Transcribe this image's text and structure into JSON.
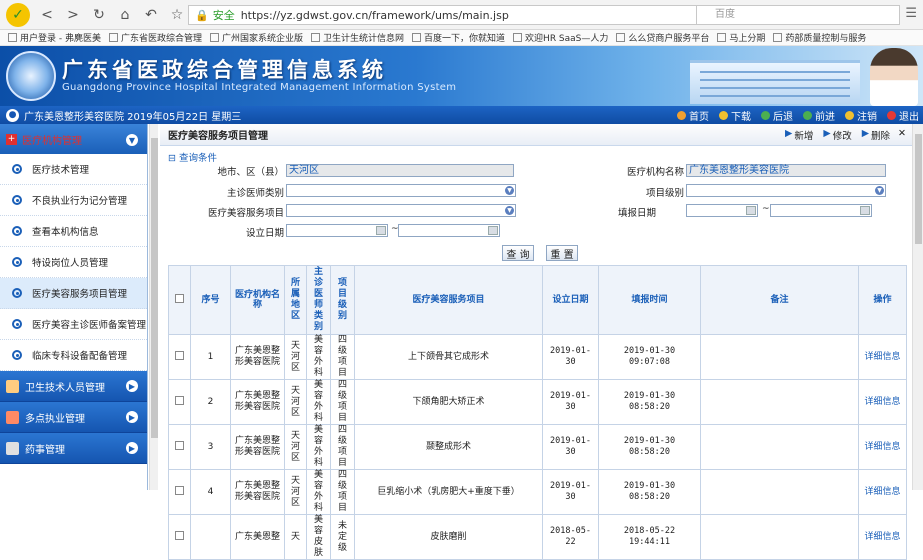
{
  "browser": {
    "secure_label": "安全",
    "url": "https://yz.gdwst.gov.cn/framework/ums/main.jsp",
    "search_placeholder": "百度"
  },
  "bookmarks": [
    "用户登录 - 弗麂医美",
    "广东省医政综合管理",
    "广州国家系统企业版",
    "卫生计生统计信息网",
    "百度一下，你就知道",
    "欢迎HR SaaS—人力",
    "么么贷商户服务平台",
    "马上分期",
    "药部质量控制与服务"
  ],
  "banner": {
    "title": "广东省医政综合管理信息系统",
    "subtitle": "Guangdong Province Hospital Integrated Management Information System"
  },
  "status": {
    "org_date": "广东美恩整形美容医院 2019年05月22日 星期三",
    "actions": [
      "首页",
      "下载",
      "后退",
      "前进",
      "注销",
      "退出"
    ]
  },
  "sidebar": {
    "header": "医疗机构管理",
    "items": [
      "医疗技术管理",
      "不良执业行为记分管理",
      "查看本机构信息",
      "特设岗位人员管理",
      "医疗美容服务项目管理",
      "医疗美容主诊医师备案管理",
      "临床专科设备配备管理"
    ],
    "groups": [
      "卫生技术人员管理",
      "多点执业管理",
      "药事管理"
    ]
  },
  "page": {
    "title": "医疗美容服务项目管理",
    "tools": [
      "新增",
      "修改",
      "删除"
    ],
    "query_label": "查询条件"
  },
  "form": {
    "district_label": "地市、区（县）",
    "district_value": "天河区",
    "org_label": "医疗机构名称",
    "org_value": "广东美恩整形美容医院",
    "doctor_type_label": "主诊医师类别",
    "level_label": "项目级别",
    "service_label": "医疗美容服务项目",
    "report_date_label": "填报日期",
    "set_date_label": "设立日期",
    "search_btn": "查 询",
    "reset_btn": "重 置"
  },
  "table": {
    "headers": [
      "序号",
      "医疗机构名称",
      "所属地区",
      "主诊医师类别",
      "项目级别",
      "医疗美容服务项目",
      "设立日期",
      "填报时间",
      "备注",
      "操作"
    ],
    "rows": [
      {
        "no": "1",
        "org": "广东美恩整形美容医院",
        "area": "天河区",
        "doctor": "美容外科",
        "level": "四级项目",
        "item": "上下颌骨其它成形术",
        "set_date": "2019-01-30",
        "report": "2019-01-30 09:07:08",
        "note": "",
        "op": "详细信息"
      },
      {
        "no": "2",
        "org": "广东美恩整形美容医院",
        "area": "天河区",
        "doctor": "美容外科",
        "level": "四级项目",
        "item": "下颌角肥大矫正术",
        "set_date": "2019-01-30",
        "report": "2019-01-30 08:58:20",
        "note": "",
        "op": "详细信息"
      },
      {
        "no": "3",
        "org": "广东美恩整形美容医院",
        "area": "天河区",
        "doctor": "美容外科",
        "level": "四级项目",
        "item": "颞整成形术",
        "set_date": "2019-01-30",
        "report": "2019-01-30 08:58:20",
        "note": "",
        "op": "详细信息"
      },
      {
        "no": "4",
        "org": "广东美恩整形美容医院",
        "area": "天河区",
        "doctor": "美容外科",
        "level": "四级项目",
        "item": "巨乳缩小术（乳房肥大+重度下垂）",
        "set_date": "2019-01-30",
        "report": "2019-01-30 08:58:20",
        "note": "",
        "op": "详细信息"
      },
      {
        "no": "",
        "org": "广东美恩整",
        "area": "天",
        "doctor": "美容皮肤",
        "level": "未定级",
        "item": "皮肤磨削",
        "set_date": "2018-05-22",
        "report": "2018-05-22 19:44:11",
        "note": "",
        "op": "详细信息"
      }
    ]
  }
}
